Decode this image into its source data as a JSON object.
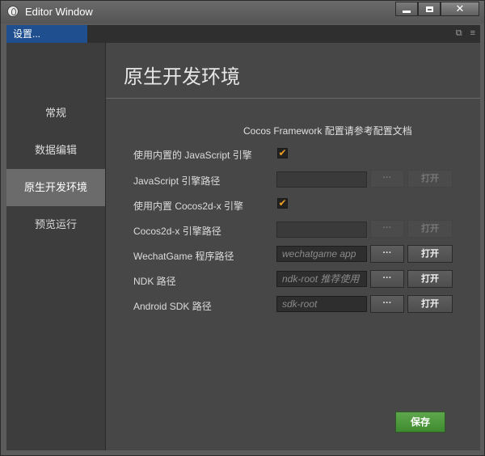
{
  "window": {
    "title": "Editor Window",
    "close_glyph": "✕"
  },
  "tab": {
    "label": "设置...",
    "tools": [
      "⧉",
      "≡"
    ]
  },
  "sidebar": {
    "items": [
      {
        "label": "常规",
        "active": false
      },
      {
        "label": "数据编辑",
        "active": false
      },
      {
        "label": "原生开发环境",
        "active": true
      },
      {
        "label": "预览运行",
        "active": false
      }
    ]
  },
  "main": {
    "title": "原生开发环境",
    "doc_link": "Cocos Framework 配置请参考配置文档",
    "rows": [
      {
        "label": "使用内置的 JavaScript 引擎",
        "checked": true
      },
      {
        "label": "JavaScript 引擎路径",
        "value": "",
        "placeholder": "",
        "dots": "···",
        "open": "打开",
        "enabled": false
      },
      {
        "label": "使用内置 Cocos2d-x 引擎",
        "checked": true
      },
      {
        "label": "Cocos2d-x 引擎路径",
        "value": "",
        "placeholder": "",
        "dots": "···",
        "open": "打开",
        "enabled": false
      },
      {
        "label": "WechatGame 程序路径",
        "value": "",
        "placeholder": "wechatgame app",
        "dots": "···",
        "open": "打开",
        "enabled": true
      },
      {
        "label": "NDK 路径",
        "value": "",
        "placeholder": "ndk-root 推荐使用",
        "dots": "···",
        "open": "打开",
        "enabled": true
      },
      {
        "label": "Android SDK 路径",
        "value": "",
        "placeholder": "sdk-root",
        "dots": "···",
        "open": "打开",
        "enabled": true
      }
    ],
    "checkmark": "✔",
    "save_label": "保存"
  },
  "colors": {
    "accent_tab": "#1f4f8f",
    "checkbox_mark": "#f0a020",
    "save_button": "#4f9a3f"
  }
}
